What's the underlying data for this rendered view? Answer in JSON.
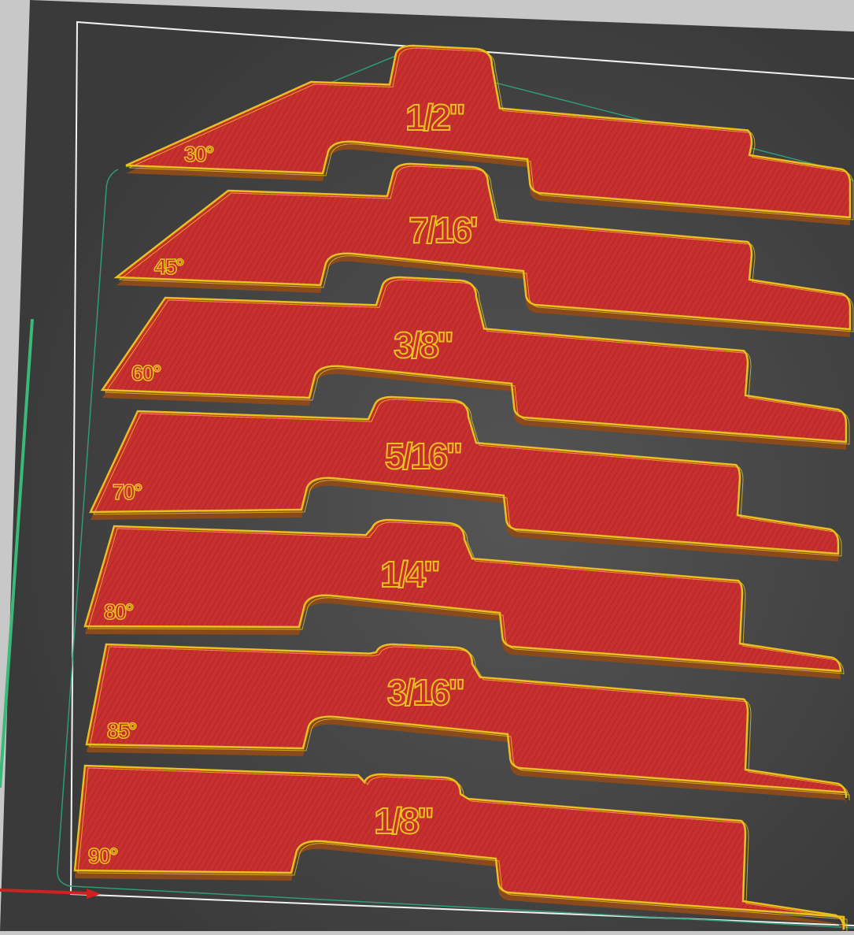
{
  "scene": {
    "description_colors": {
      "background": "#c8c8c8",
      "bed": "#3d3d3d",
      "bed_highlight": "#505050",
      "bed_border": "#f2f2f2",
      "skirt": "#2f9a7c",
      "part_fill": "#c83030",
      "part_side": "#8a4a1c",
      "part_edge": "#e8c020",
      "axis_x": "#d02020",
      "axis_y": "#3cb878"
    },
    "gauges": [
      {
        "size_label": "1/2\"",
        "angle_label": "30°"
      },
      {
        "size_label": "7/16'",
        "angle_label": "45°"
      },
      {
        "size_label": "3/8\"",
        "angle_label": "60°"
      },
      {
        "size_label": "5/16\"",
        "angle_label": "70°"
      },
      {
        "size_label": "1/4\"",
        "angle_label": "80°"
      },
      {
        "size_label": "3/16\"",
        "angle_label": "85°"
      },
      {
        "size_label": "1/8\"",
        "angle_label": "90°"
      }
    ]
  }
}
